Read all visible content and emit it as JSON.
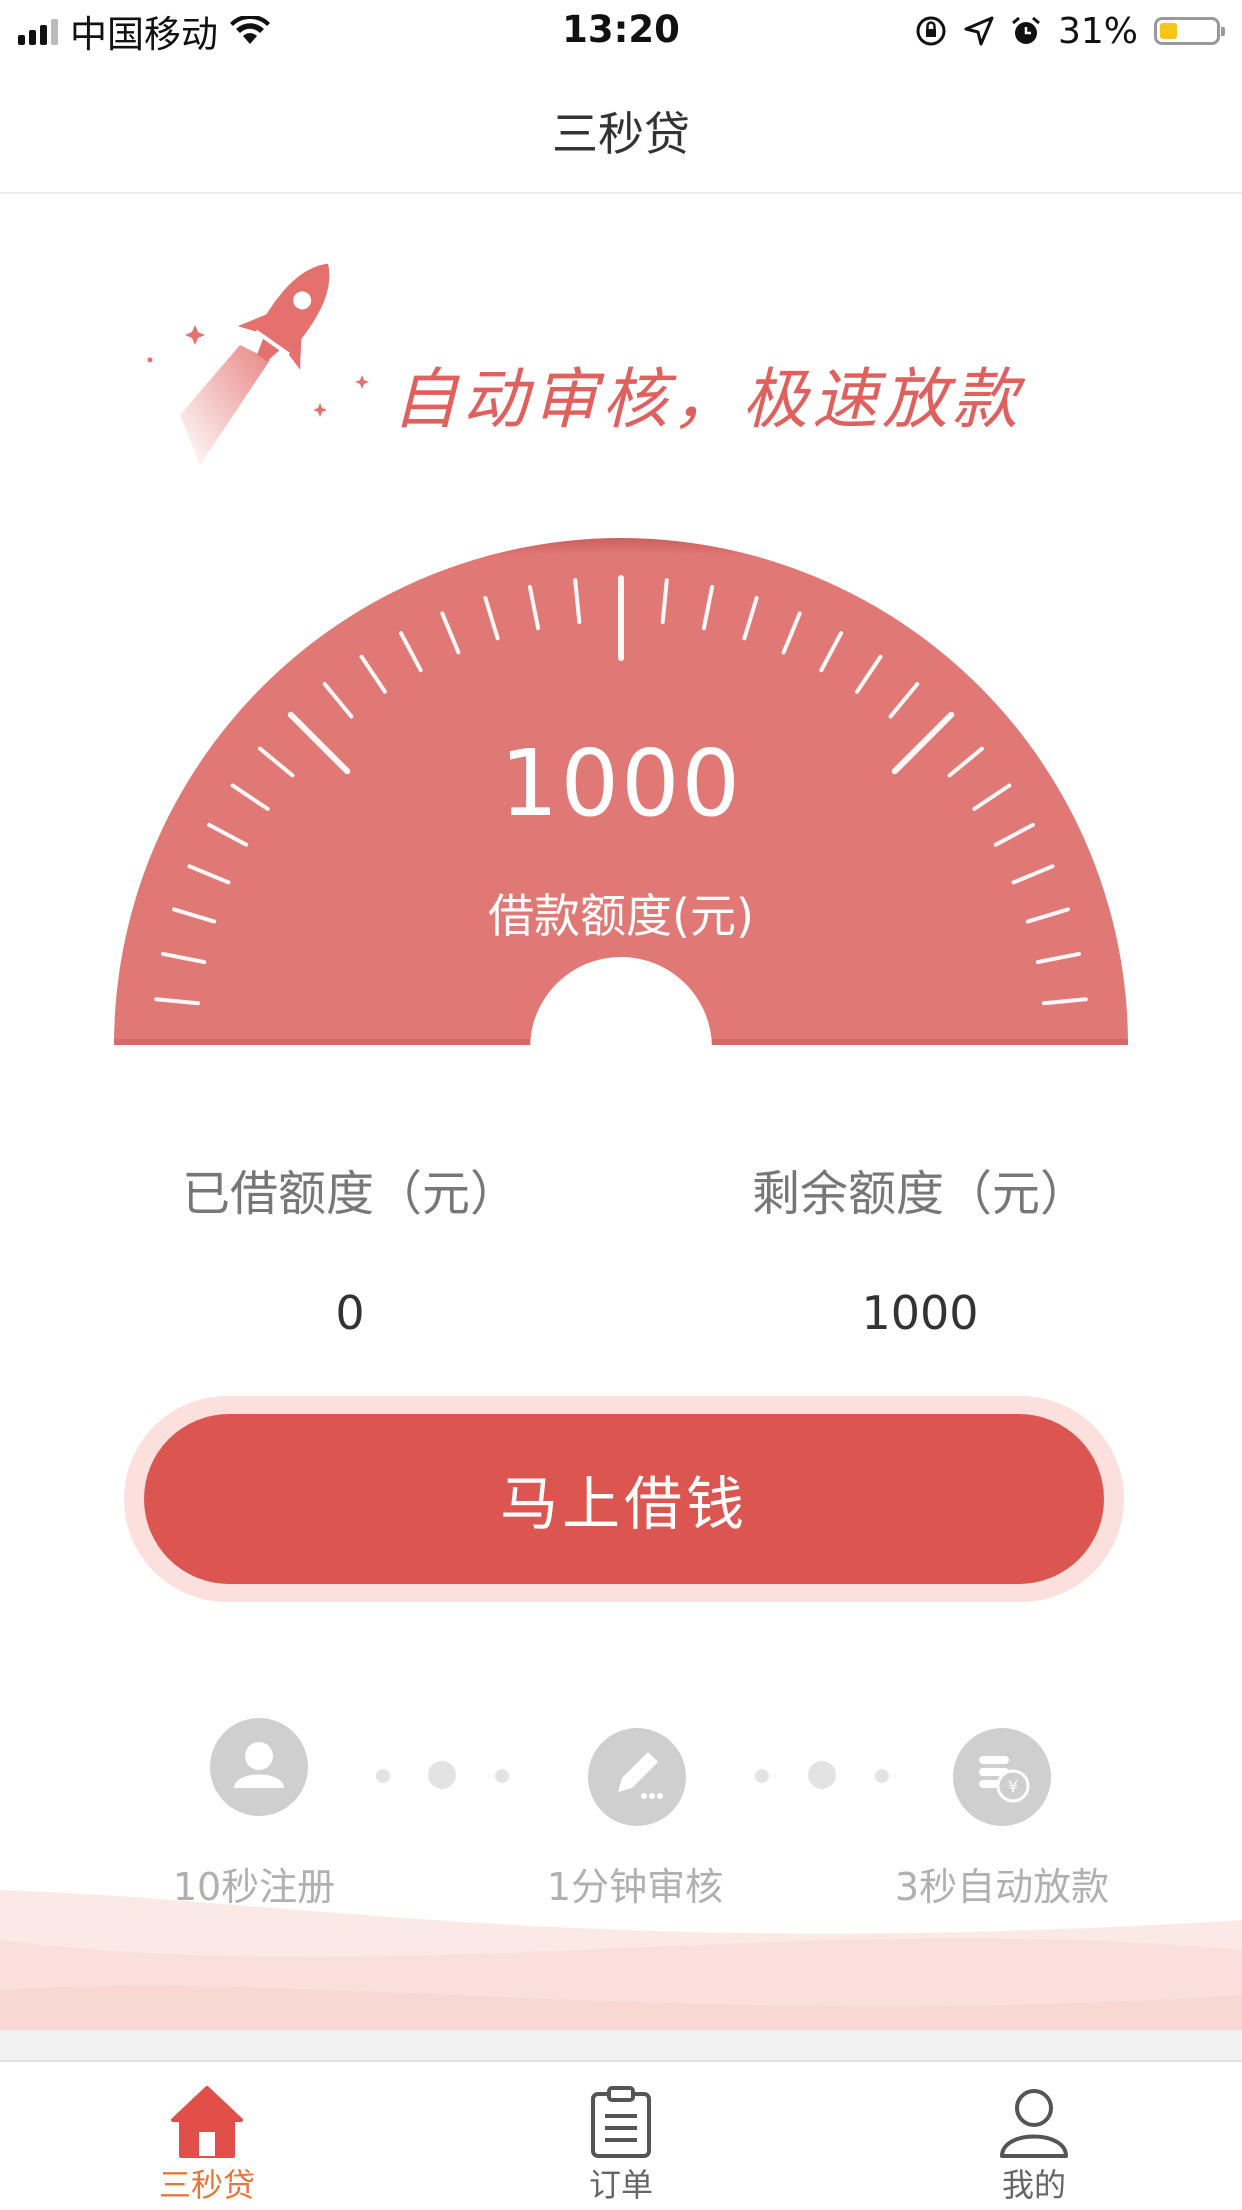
{
  "status_bar": {
    "carrier": "中国移动",
    "time": "13:20",
    "battery_percent": "31%",
    "battery_level": 0.31,
    "battery_color": "#f5c518"
  },
  "nav": {
    "title": "三秒贷"
  },
  "slogan": "自动审核，极速放款",
  "gauge": {
    "amount": "1000",
    "label": "借款额度(元)",
    "color": "#e07875"
  },
  "stats": {
    "borrowed": {
      "label": "已借额度（元）",
      "value": "0"
    },
    "remaining": {
      "label": "剩余额度（元）",
      "value": "1000"
    }
  },
  "cta": {
    "label": "马上借钱",
    "color": "#db5651"
  },
  "steps": [
    {
      "label": "10秒注册",
      "icon": "user-icon"
    },
    {
      "label": "1分钟审核",
      "icon": "pencil-icon"
    },
    {
      "label": "3秒自动放款",
      "icon": "coins-icon"
    }
  ],
  "tabbar": {
    "active_color": "#e8763a",
    "tabs": [
      {
        "label": "三秒贷",
        "icon": "home-icon",
        "active": true
      },
      {
        "label": "订单",
        "icon": "clipboard-icon",
        "active": false
      },
      {
        "label": "我的",
        "icon": "person-icon",
        "active": false
      }
    ]
  }
}
